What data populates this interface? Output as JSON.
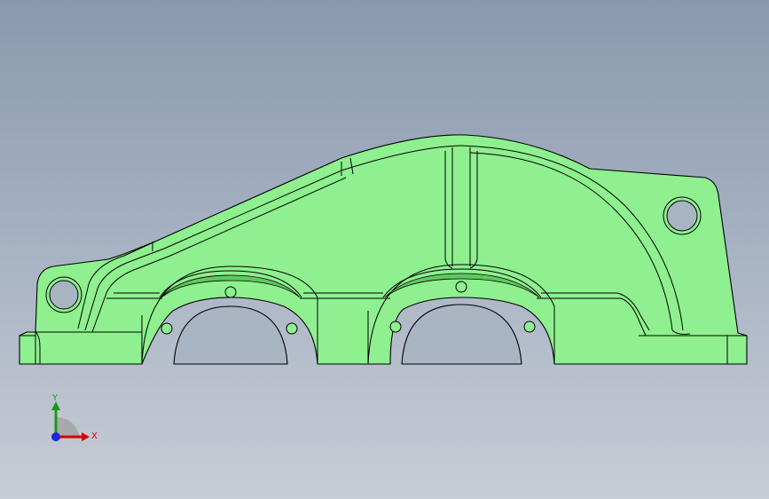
{
  "viewport": {
    "background_top": "#8a99ae",
    "background_bottom": "#c8cdd6"
  },
  "model": {
    "part_color": "#8ef08e",
    "edge_color": "#000000"
  },
  "triad": {
    "x_label": "X",
    "y_label": "Y",
    "x_color": "#d40000",
    "y_color": "#1a9a1a",
    "z_color": "#1e2ad8"
  }
}
